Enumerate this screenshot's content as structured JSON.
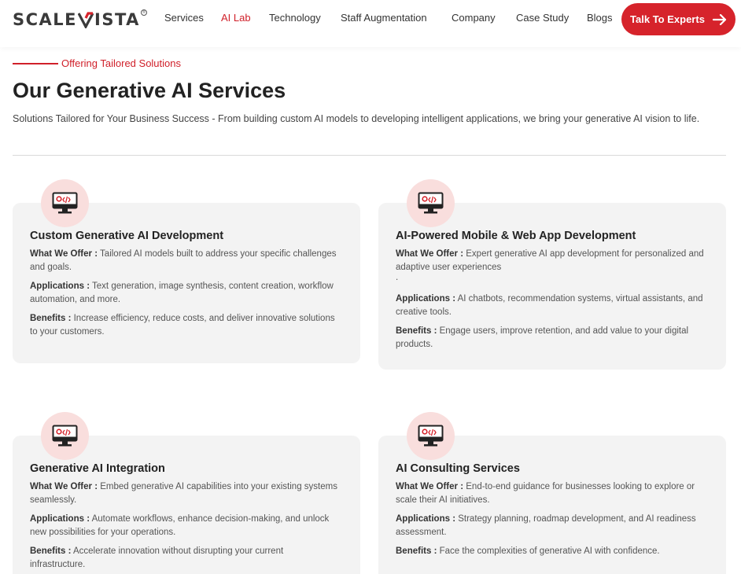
{
  "header": {
    "logo": {
      "part1": "SCALE",
      "part2": "ISTA"
    },
    "nav": [
      {
        "label": "Services",
        "active": false
      },
      {
        "label": "AI Lab",
        "active": true
      },
      {
        "label": "Technology",
        "active": false
      },
      {
        "label": "Staff Augmentation",
        "active": false
      },
      {
        "label": "Company",
        "active": false
      },
      {
        "label": "Case Study",
        "active": false
      },
      {
        "label": "Blogs",
        "active": false
      }
    ],
    "cta_label": "Talk To Experts"
  },
  "intro": {
    "eyebrow": "Offering Tailored Solutions",
    "title": "Our Generative AI Services",
    "description": "Solutions Tailored for Your Business Success - From building custom AI models to developing intelligent applications, we bring your generative AI vision to life."
  },
  "cards": [
    {
      "title": "Custom Generative AI Development",
      "offer_label": "What We Offer :",
      "offer": "Tailored AI models built to address your specific challenges and goals.",
      "applications_label": "Applications :",
      "applications": "Text generation, image synthesis, content creation, workflow automation, and more.",
      "benefits_label": "Benefits :",
      "benefits": "Increase efficiency, reduce costs, and deliver innovative solutions to your customers."
    },
    {
      "title": "AI-Powered Mobile & Web App Development",
      "offer_label": "What We Offer :",
      "offer": "Expert generative AI app development for personalized and adaptive user experiences",
      "offer_extra": ".",
      "applications_label": "Applications :",
      "applications": "AI chatbots, recommendation systems, virtual assistants, and creative tools.",
      "benefits_label": "Benefits :",
      "benefits": "Engage users, improve retention, and add value to your digital products."
    },
    {
      "title": "Generative AI Integration",
      "offer_label": "What We Offer :",
      "offer": "Embed generative AI capabilities into your existing systems seamlessly.",
      "applications_label": "Applications :",
      "applications": "Automate workflows, enhance decision-making, and unlock new possibilities for your operations.",
      "benefits_label": "Benefits :",
      "benefits": "Accelerate innovation without disrupting your current infrastructure."
    },
    {
      "title": "AI Consulting Services",
      "offer_label": "What We Offer :",
      "offer": "End-to-end guidance for businesses looking to explore or scale their AI initiatives.",
      "applications_label": "Applications :",
      "applications": "Strategy planning, roadmap development, and AI readiness assessment.",
      "benefits_label": "Benefits :",
      "benefits": "Face the complexities of generative AI with confidence."
    }
  ],
  "colors": {
    "brand_red": "#d6232b",
    "card_bg": "#f3f3f3",
    "icon_bg": "#f9dedd"
  }
}
